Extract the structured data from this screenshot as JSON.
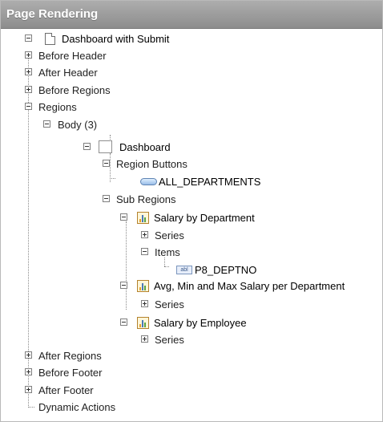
{
  "panel": {
    "title": "Page Rendering"
  },
  "tree": {
    "root": "Dashboard with Submit",
    "before_header": "Before Header",
    "after_header": "After Header",
    "before_regions": "Before Regions",
    "regions": "Regions",
    "body": "Body (3)",
    "dashboard": "Dashboard",
    "region_buttons": "Region Buttons",
    "all_departments": "ALL_DEPARTMENTS",
    "sub_regions": "Sub Regions",
    "salary_by_department": "Salary by Department",
    "series_1": "Series",
    "items": "Items",
    "item_icon_text": "abl",
    "p8_deptno": "P8_DEPTNO",
    "avg_min_max": "Avg, Min and Max Salary per Department",
    "series_2": "Series",
    "salary_by_employee": "Salary by Employee",
    "series_3": "Series",
    "after_regions": "After Regions",
    "before_footer": "Before Footer",
    "after_footer": "After Footer",
    "dynamic_actions": "Dynamic Actions"
  },
  "icons": {
    "toggle_collapsed": "plus-box-icon",
    "toggle_expanded": "minus-box-icon",
    "page": "page-icon",
    "region": "region-icon",
    "button": "button-icon",
    "chart": "chart-icon",
    "item": "text-item-icon"
  },
  "colors": {
    "header_bg": "#9b9b9b",
    "header_text": "#ffffff",
    "tree_text": "#222222",
    "button_icon": "#99bde8",
    "chart_icon": "#e6a12a"
  }
}
